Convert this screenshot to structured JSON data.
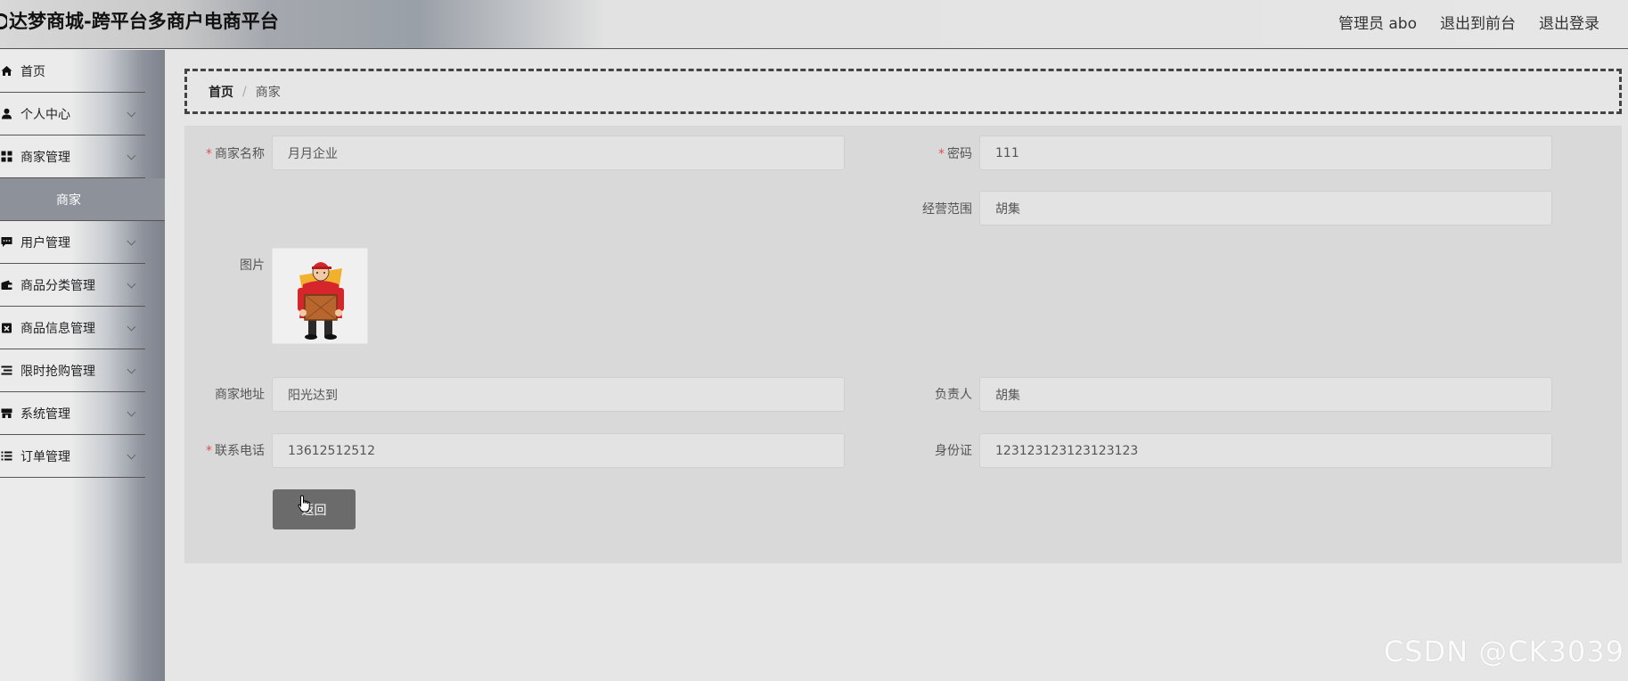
{
  "header": {
    "title": "达梦商城-跨平台多商户电商平台",
    "links": [
      "管理员 abo",
      "退出到前台",
      "退出登录"
    ]
  },
  "sidebar": {
    "items": [
      {
        "label": "首页",
        "icon": "home-icon",
        "has_children": false
      },
      {
        "label": "个人中心",
        "icon": "user-icon",
        "has_children": true
      },
      {
        "label": "商家管理",
        "icon": "grid-icon",
        "has_children": true
      },
      {
        "label": "用户管理",
        "icon": "chat-icon",
        "has_children": true
      },
      {
        "label": "商品分类管理",
        "icon": "wallet-icon",
        "has_children": true
      },
      {
        "label": "商品信息管理",
        "icon": "clipboard-x-icon",
        "has_children": true
      },
      {
        "label": "限时抢购管理",
        "icon": "list-icon",
        "has_children": true
      },
      {
        "label": "系统管理",
        "icon": "store-icon",
        "has_children": true
      },
      {
        "label": "订单管理",
        "icon": "list-check-icon",
        "has_children": true
      }
    ],
    "active_sub": "商家"
  },
  "breadcrumb": {
    "home": "首页",
    "separator": "/",
    "current": "商家"
  },
  "form": {
    "merchant_name": {
      "label": "商家名称",
      "value": "月月企业",
      "required": true
    },
    "password": {
      "label": "密码",
      "value": "111",
      "required": true
    },
    "business_scope": {
      "label": "经营范围",
      "value": "胡集",
      "required": false
    },
    "image": {
      "label": "图片",
      "icon": "delivery-person-image"
    },
    "address": {
      "label": "商家地址",
      "value": "阳光达到",
      "required": false
    },
    "person_in_charge": {
      "label": "负责人",
      "value": "胡集",
      "required": false
    },
    "phone": {
      "label": "联系电话",
      "value": "13612512512",
      "required": true
    },
    "id_card": {
      "label": "身份证",
      "value": "123123123123123123",
      "required": false
    },
    "back_button": "返回"
  },
  "watermark": "CSDN @CK3039",
  "colors": {
    "required": "#e05050",
    "active_menu": "#8d9199",
    "button": "#6b6b6b"
  }
}
